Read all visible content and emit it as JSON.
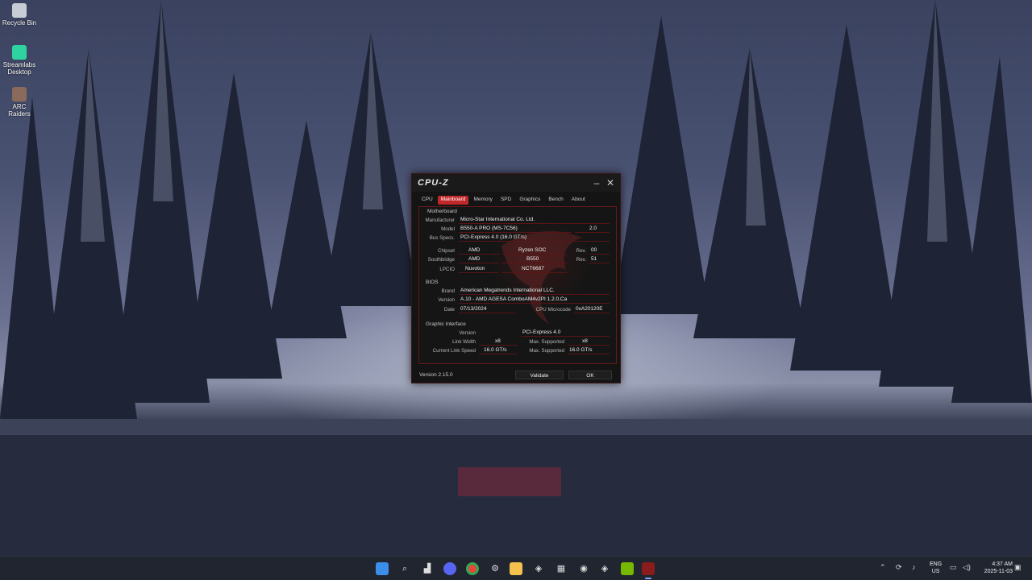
{
  "desktop": {
    "icons": [
      {
        "label": "Recycle Bin",
        "icon": "recycle-bin-icon"
      },
      {
        "label": "Streamlabs Desktop",
        "icon": "streamlabs-icon"
      },
      {
        "label": "ARC Raiders",
        "icon": "arc-raiders-icon"
      }
    ]
  },
  "cpuz": {
    "title": "CPU-Z",
    "tabs": [
      "CPU",
      "Mainboard",
      "Memory",
      "SPD",
      "Graphics",
      "Bench",
      "About"
    ],
    "active_tab": "Mainboard",
    "motherboard": {
      "section": "Motherboard",
      "manufacturer_label": "Manufacturer",
      "manufacturer": "Micro-Star International Co. Ltd.",
      "model_label": "Model",
      "model": "B550-A PRO (MS-7C56)",
      "model_rev": "2.0",
      "bus_label": "Bus Specs.",
      "bus": "PCI-Express 4.0 (16.0 GT/s)",
      "chipset_label": "Chipset",
      "chipset_vendor": "AMD",
      "chipset_name": "Ryzen SOC",
      "chipset_rev_label": "Rev.",
      "chipset_rev": "00",
      "southbridge_label": "Southbridge",
      "southbridge_vendor": "AMD",
      "southbridge_name": "B550",
      "southbridge_rev_label": "Rev.",
      "southbridge_rev": "51",
      "lpcio_label": "LPCIO",
      "lpcio_vendor": "Nuvoton",
      "lpcio_name": "NCT6687"
    },
    "bios": {
      "section": "BIOS",
      "brand_label": "Brand",
      "brand": "American Megatrends International LLC.",
      "version_label": "Version",
      "version": "A.10 - AMD AGESA ComboAM4v2PI 1.2.0.Ca",
      "date_label": "Date",
      "date": "07/13/2024",
      "microcode_label": "CPU Microcode",
      "microcode": "0xA20120E"
    },
    "graphic": {
      "section": "Graphic Interface",
      "version_label": "Version",
      "version": "PCI-Express 4.0",
      "link_width_label": "Link Width",
      "link_width": "x8",
      "max_width_label": "Max. Supported",
      "max_width": "x8",
      "link_speed_label": "Current Link Speed",
      "link_speed": "16.0 GT/s",
      "max_speed_label": "Max. Supported",
      "max_speed": "16.0 GT/s"
    },
    "footer": {
      "version": "Version 2.15.0",
      "validate": "Validate",
      "ok": "OK"
    }
  },
  "taskbar": {
    "items": [
      "start-icon",
      "search-icon",
      "task-view-icon",
      "discord-icon",
      "chrome-icon",
      "app-icon",
      "file-explorer-icon",
      "steam-icon",
      "calculator-icon",
      "obs-icon",
      "steam-alt-icon",
      "nvidia-icon",
      "cpuz-icon"
    ],
    "lang_top": "ENG",
    "lang_bottom": "US",
    "time": "4:37 AM",
    "date": "2025-11-03"
  },
  "colors": {
    "accent": "#c0282a",
    "taskbar": "#202530"
  }
}
